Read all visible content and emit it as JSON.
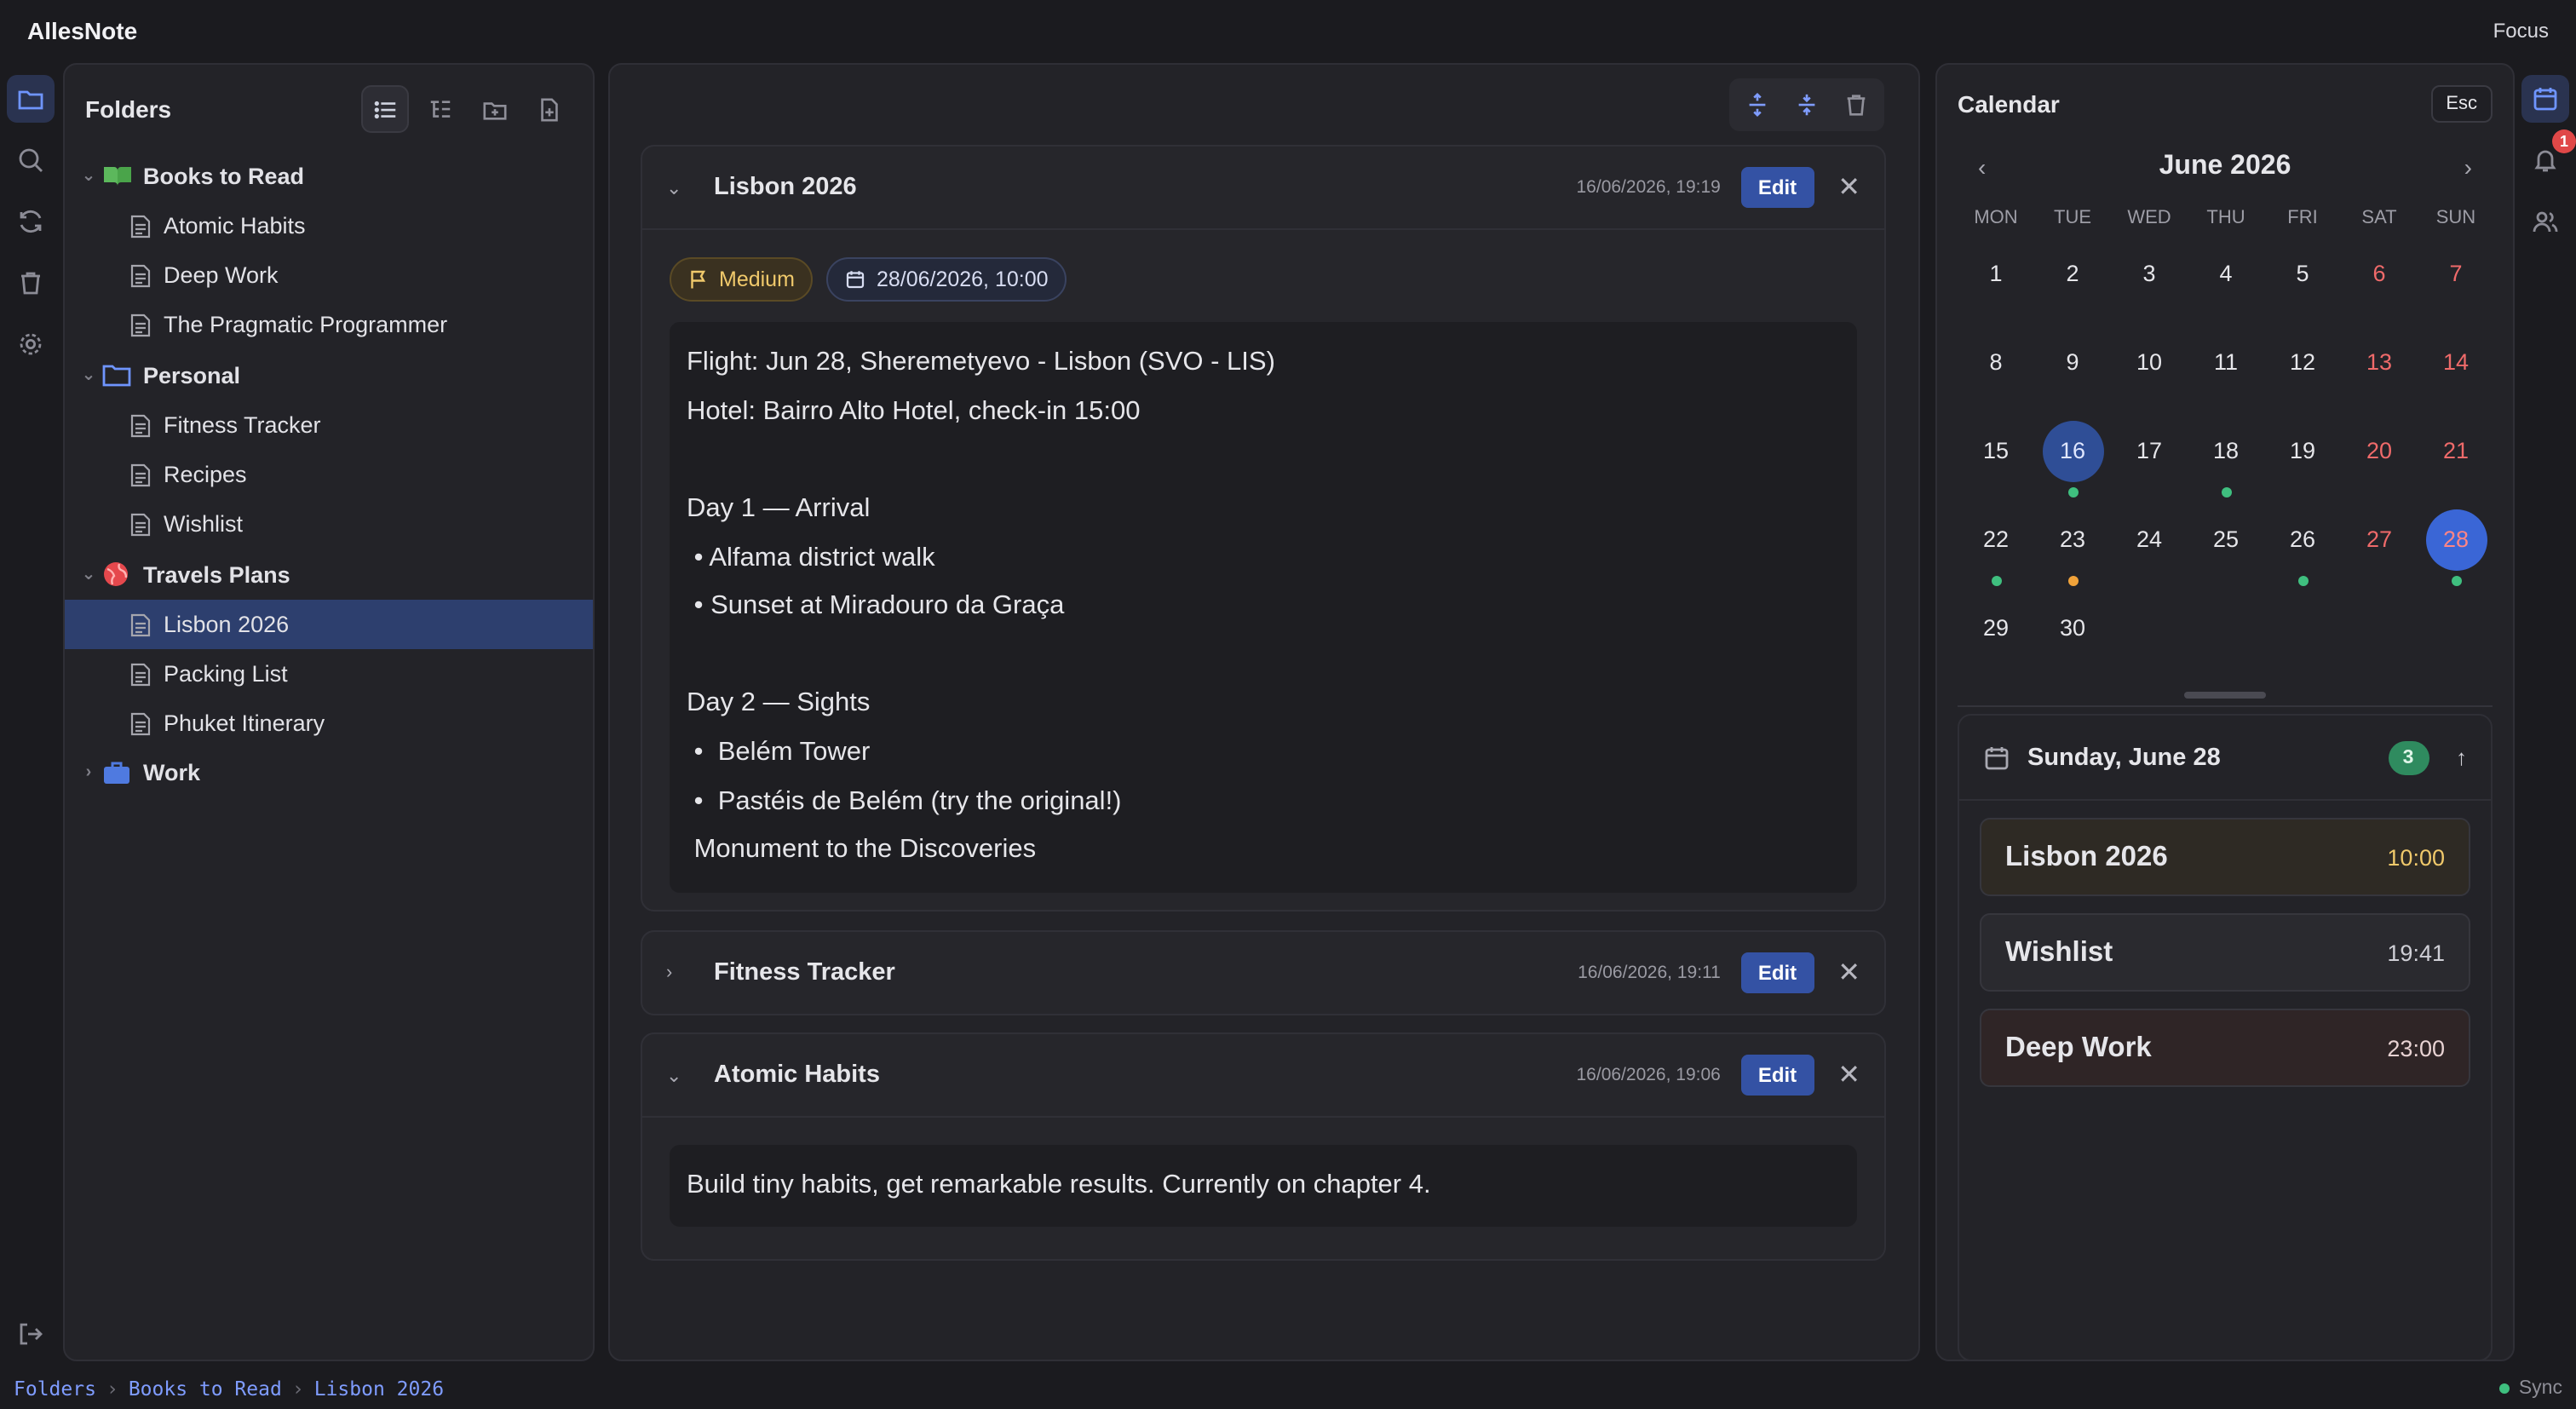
{
  "app": {
    "title": "AllesNote",
    "focus_label": "Focus"
  },
  "folders_panel": {
    "title": "Folders",
    "groups": [
      {
        "name": "Books to Read",
        "icon": "book-icon",
        "expanded": true,
        "notes": [
          "Atomic Habits",
          "Deep Work",
          "The Pragmatic Programmer"
        ]
      },
      {
        "name": "Personal",
        "icon": "folder-icon",
        "expanded": true,
        "notes": [
          "Fitness Tracker",
          "Recipes",
          "Wishlist"
        ]
      },
      {
        "name": "Travels Plans",
        "icon": "globe-icon",
        "expanded": true,
        "notes": [
          "Lisbon 2026",
          "Packing List",
          "Phuket Itinerary"
        ]
      },
      {
        "name": "Work",
        "icon": "briefcase-icon",
        "expanded": false,
        "notes": []
      }
    ],
    "selected_note": "Lisbon 2026"
  },
  "notes": [
    {
      "title": "Lisbon 2026",
      "date": "16/06/2026, 19:19",
      "edit_label": "Edit",
      "expanded": true,
      "priority": "Medium",
      "due": "28/06/2026, 10:00",
      "lines": [
        "Flight: Jun 28, Sheremetyevo - Lisbon (SVO - LIS)",
        "Hotel: Bairro Alto Hotel, check-in 15:00",
        "",
        "Day 1 — Arrival",
        " • Alfama district walk",
        " • Sunset at Miradouro da Graça",
        "",
        "Day 2 — Sights",
        " •  Belém Tower",
        " •  Pastéis de Belém (try the original!)",
        " Monument to the Discoveries"
      ]
    },
    {
      "title": "Fitness Tracker",
      "date": "16/06/2026, 19:11",
      "edit_label": "Edit",
      "expanded": false
    },
    {
      "title": "Atomic Habits",
      "date": "16/06/2026, 19:06",
      "edit_label": "Edit",
      "expanded": true,
      "body": "Build tiny habits, get remarkable results. Currently on chapter 4."
    }
  ],
  "calendar": {
    "title": "Calendar",
    "esc_label": "Esc",
    "month": "June 2026",
    "weekdays": [
      "MON",
      "TUE",
      "WED",
      "THU",
      "FRI",
      "SAT",
      "SUN"
    ],
    "days": [
      "1",
      "2",
      "3",
      "4",
      "5",
      "6",
      "7",
      "8",
      "9",
      "10",
      "11",
      "12",
      "13",
      "14",
      "15",
      "16",
      "17",
      "18",
      "19",
      "20",
      "21",
      "22",
      "23",
      "24",
      "25",
      "26",
      "27",
      "28",
      "29",
      "30"
    ],
    "today": "16",
    "selected": "28",
    "dots": {
      "16": "#3fbf7f",
      "18": "#3fbf7f",
      "22": "#3fbf7f",
      "23": "#f0a23a",
      "26": "#3fbf7f",
      "28": "#3fbf7f"
    },
    "agenda": {
      "title": "Sunday, June 28",
      "count": "3",
      "events": [
        {
          "title": "Lisbon 2026",
          "time": "10:00",
          "bg": "#2e2a24",
          "time_color": "#f0c96b"
        },
        {
          "title": "Wishlist",
          "time": "19:41",
          "bg": "#2a2a2f",
          "time_color": "#cfcfd6"
        },
        {
          "title": "Deep Work",
          "time": "23:00",
          "bg": "#2f2526",
          "time_color": "#e8d3d3"
        }
      ]
    }
  },
  "right_rail": {
    "notification_count": "1"
  },
  "status": {
    "crumbs": [
      "Folders",
      "Books to Read",
      "Lisbon 2026"
    ],
    "sync_label": "Sync"
  },
  "colors": {
    "accent": "#3452a4",
    "selected_row": "#2d3f6e",
    "weekend": "#ef6a6a"
  }
}
